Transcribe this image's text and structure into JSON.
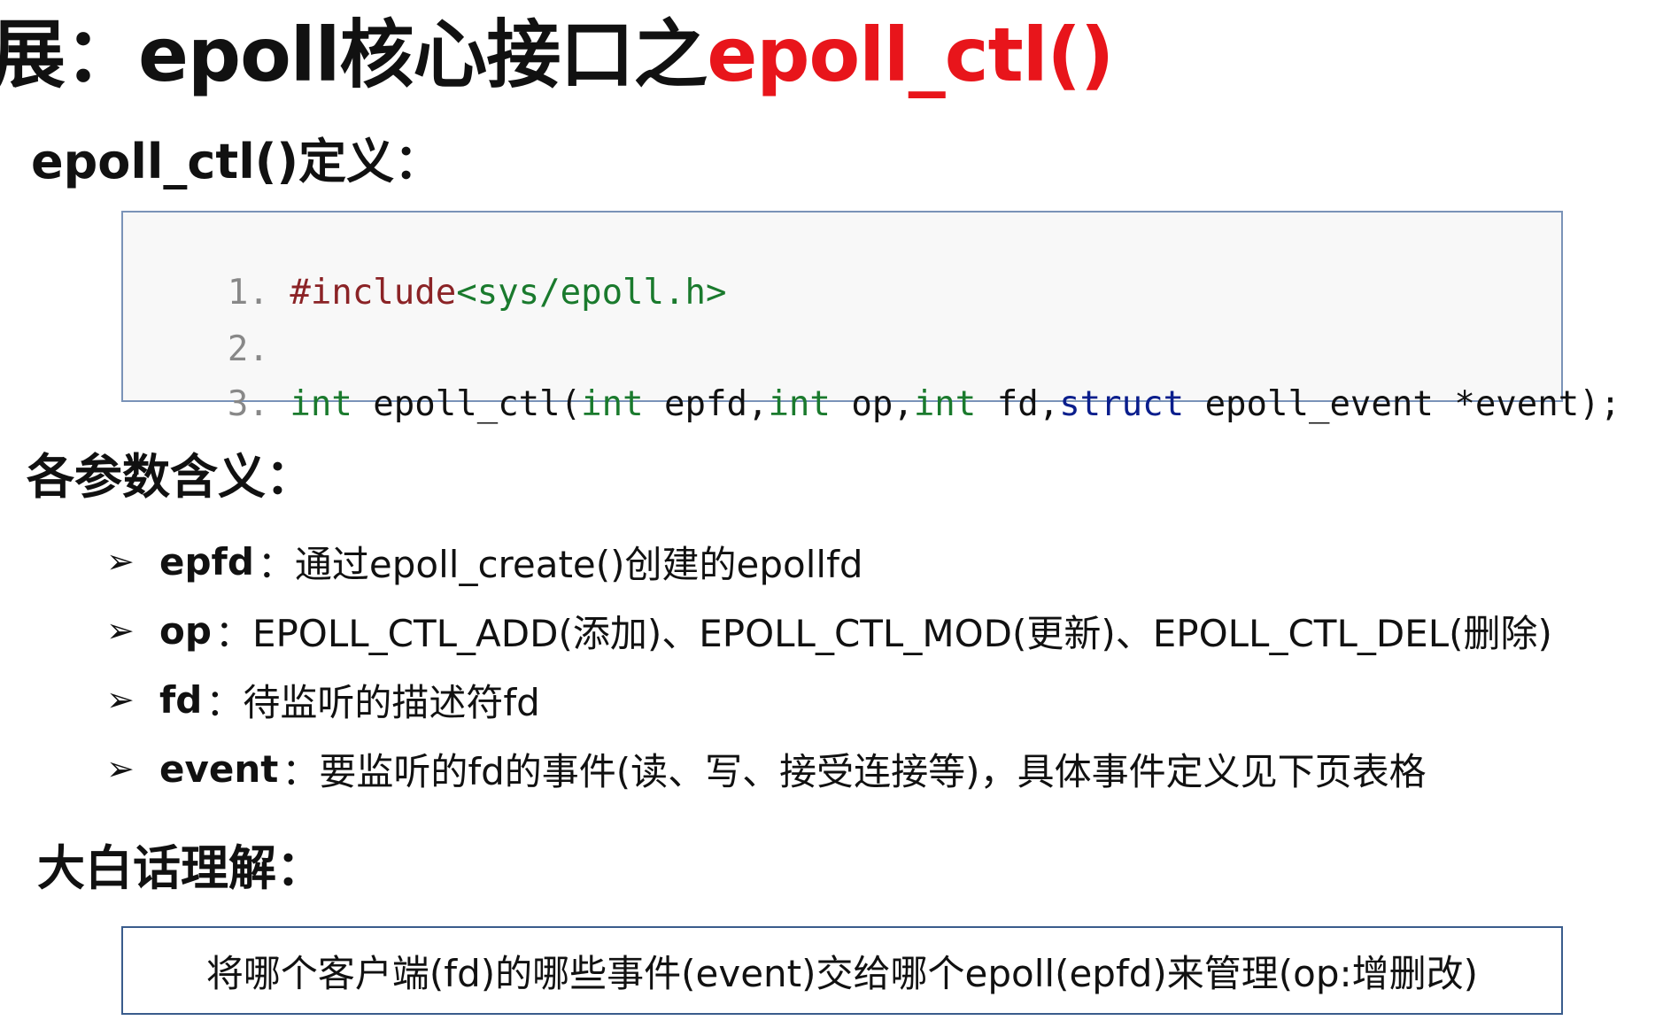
{
  "title": {
    "prefix": "展：epoll核心接口之",
    "highlight": "epoll_ctl()"
  },
  "definition": {
    "heading": "epoll_ctl()定义：",
    "lines": [
      {
        "num": "1.",
        "segments": [
          {
            "text": "#include",
            "cls": "pp"
          },
          {
            "text": "<sys/epoll.h>",
            "cls": "st"
          }
        ]
      },
      {
        "num": "2.",
        "segments": []
      },
      {
        "num": "3.",
        "segments": [
          {
            "text": "int",
            "cls": "kw"
          },
          {
            "text": " epoll_ctl(",
            "cls": ""
          },
          {
            "text": "int",
            "cls": "kw"
          },
          {
            "text": " epfd,",
            "cls": ""
          },
          {
            "text": "int",
            "cls": "kw"
          },
          {
            "text": " op,",
            "cls": ""
          },
          {
            "text": "int",
            "cls": "kw"
          },
          {
            "text": " fd,",
            "cls": ""
          },
          {
            "text": "struct",
            "cls": "ty"
          },
          {
            "text": " epoll_event *event);",
            "cls": ""
          }
        ]
      }
    ]
  },
  "params": {
    "heading": "各参数含义：",
    "items": [
      {
        "key": "epfd",
        "sep": "：",
        "desc": "通过epoll_create()创建的epollfd"
      },
      {
        "key": "op",
        "sep": "：",
        "desc": "EPOLL_CTL_ADD(添加)、EPOLL_CTL_MOD(更新)、EPOLL_CTL_DEL(删除)"
      },
      {
        "key": "fd",
        "sep": "：",
        "desc": "待监听的描述符fd"
      },
      {
        "key": "event",
        "sep": "：",
        "desc": "要监听的fd的事件(读、写、接受连接等)，具体事件定义见下页表格"
      }
    ]
  },
  "summary": {
    "heading": "大白话理解：",
    "text": "将哪个客户端(fd)的哪些事件(event)交给哪个epoll(epfd)来管理(op:增删改)"
  },
  "colors": {
    "title_highlight": "#e8151b",
    "code_border": "#7a93b8",
    "summary_border": "#3a5c8c"
  }
}
